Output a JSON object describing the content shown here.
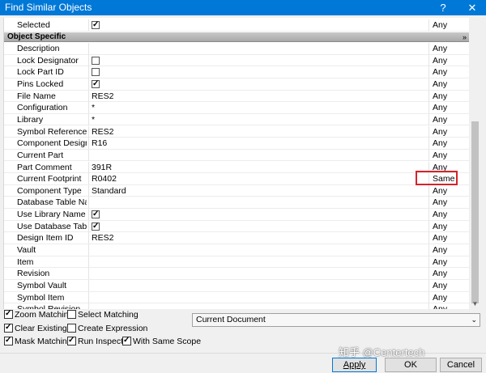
{
  "window": {
    "title": "Find Similar Objects",
    "help": "?",
    "close": "✕"
  },
  "grid": {
    "top_row": {
      "name": "Selected",
      "checked": true,
      "match": "Any"
    },
    "section": {
      "label": "Object Specific",
      "chevron": "»"
    },
    "rows": [
      {
        "name": "Description",
        "value": "",
        "match": "Any"
      },
      {
        "name": "Lock Designator",
        "checkbox": true,
        "checked": false,
        "match": "Any"
      },
      {
        "name": "Lock Part ID",
        "checkbox": true,
        "checked": false,
        "match": "Any"
      },
      {
        "name": "Pins Locked",
        "checkbox": true,
        "checked": true,
        "match": "Any"
      },
      {
        "name": "File Name",
        "value": "RES2",
        "match": "Any"
      },
      {
        "name": "Configuration",
        "value": "*",
        "match": "Any"
      },
      {
        "name": "Library",
        "value": "*",
        "match": "Any"
      },
      {
        "name": "Symbol Reference",
        "value": "RES2",
        "match": "Any"
      },
      {
        "name": "Component Designator",
        "value": "R16",
        "match": "Any"
      },
      {
        "name": "Current Part",
        "value": "",
        "match": "Any"
      },
      {
        "name": "Part Comment",
        "value": "391R",
        "match": "Any"
      },
      {
        "name": "Current Footprint",
        "value": "R0402",
        "match": "Same"
      },
      {
        "name": "Component Type",
        "value": "Standard",
        "match": "Any"
      },
      {
        "name": "Database Table Name",
        "value": "",
        "match": "Any"
      },
      {
        "name": "Use Library Name",
        "checkbox": true,
        "checked": true,
        "match": "Any"
      },
      {
        "name": "Use Database Table Name",
        "checkbox": true,
        "checked": true,
        "match": "Any"
      },
      {
        "name": "Design Item ID",
        "value": "RES2",
        "match": "Any"
      },
      {
        "name": "Vault",
        "value": "",
        "match": "Any"
      },
      {
        "name": "Item",
        "value": "",
        "match": "Any"
      },
      {
        "name": "Revision",
        "value": "",
        "match": "Any"
      },
      {
        "name": "Symbol Vault",
        "value": "",
        "match": "Any"
      },
      {
        "name": "Symbol Item",
        "value": "",
        "match": "Any"
      },
      {
        "name": "Symbol Revision",
        "value": "",
        "match": "Any"
      }
    ]
  },
  "options": {
    "zoom_matching": {
      "label": "Zoom Matching",
      "checked": true
    },
    "select_matching": {
      "label": "Select Matching",
      "checked": false
    },
    "clear_existing": {
      "label": "Clear Existing",
      "checked": true
    },
    "create_expression": {
      "label": "Create Expression",
      "checked": false
    },
    "mask_matching": {
      "label": "Mask Matching",
      "checked": true
    },
    "run_inspector": {
      "label": "Run Inspector",
      "checked": true
    },
    "with_same_scope": {
      "label": "With Same Scope",
      "checked": true
    }
  },
  "scope": {
    "selected": "Current Document"
  },
  "buttons": {
    "apply": "Apply",
    "ok": "OK",
    "cancel": "Cancel"
  },
  "watermark": "知乎 @Centertech",
  "colors": {
    "titlebar": "#0078d7",
    "highlight": "#d6232a"
  }
}
